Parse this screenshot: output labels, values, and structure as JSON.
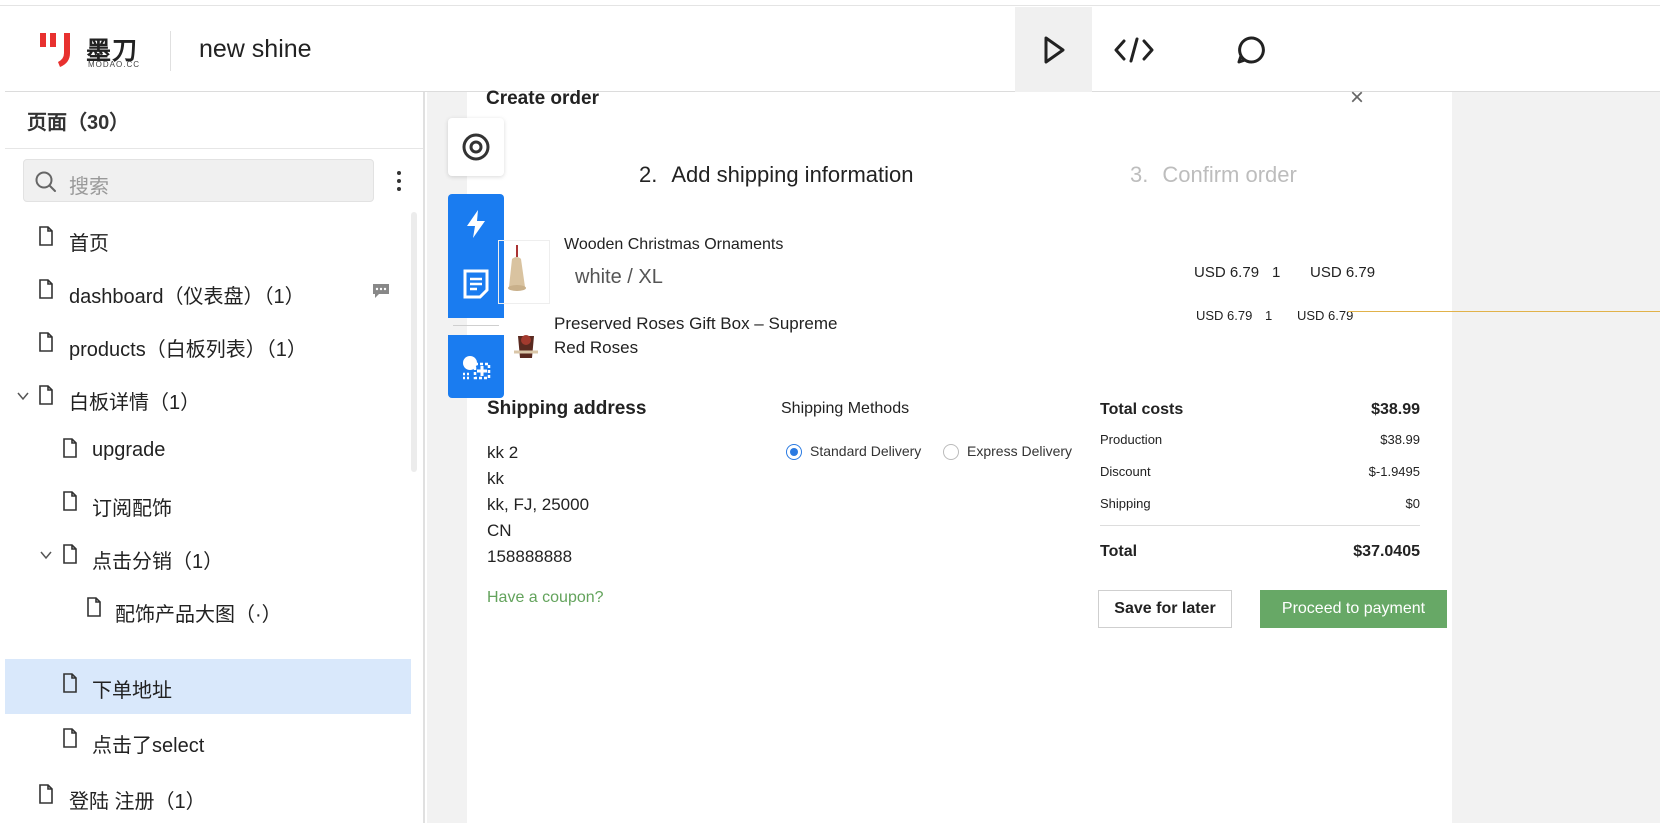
{
  "header": {
    "logo_cn": "墨刀",
    "logo_en": "MODAO.CC",
    "project_name": "new shine",
    "icons": [
      "play-icon",
      "code-icon",
      "comment-icon"
    ]
  },
  "sidebar": {
    "title": "页面（30）",
    "search_placeholder": "搜索",
    "items": [
      {
        "label": "首页"
      },
      {
        "label": "dashboard（仪表盘）（1）"
      },
      {
        "label": "products（白板列表）（1）"
      },
      {
        "label": "白板详情（1）"
      },
      {
        "label": "upgrade"
      },
      {
        "label": "订阅配饰"
      },
      {
        "label": "点击分销（1）"
      },
      {
        "label": "配饰产品大图（·）"
      },
      {
        "label": "下单地址"
      },
      {
        "label": "点击了select"
      },
      {
        "label": "登陆 注册（1）"
      }
    ],
    "selected": "下单地址"
  },
  "order": {
    "title": "Create order",
    "step2_num": "2.",
    "step2_label": "Add shipping information",
    "step3_num": "3.",
    "step3_label": "Confirm order",
    "products": [
      {
        "name": "Wooden Christmas Ornaments",
        "variant": "white / XL",
        "price": "USD 6.79",
        "qty": "1",
        "total": "USD 6.79"
      },
      {
        "name": "Preserved Roses Gift Box – Supreme Red Roses",
        "price": "USD 6.79",
        "qty": "1",
        "total": "USD 6.79"
      }
    ],
    "shipping_address": {
      "title": "Shipping address",
      "lines": [
        "kk 2",
        "kk",
        "kk, FJ, 25000",
        "CN",
        "158888888"
      ]
    },
    "shipping_methods": {
      "title": "Shipping Methods",
      "options": [
        "Standard Delivery",
        "Express Delivery"
      ],
      "selected": "Standard Delivery"
    },
    "costs": {
      "total_costs_label": "Total costs",
      "total_costs": "$38.99",
      "production_label": "Production",
      "production": "$38.99",
      "discount_label": "Discount",
      "discount": "$-1.9495",
      "shipping_label": "Shipping",
      "shipping": "$0",
      "total_label": "Total",
      "total": "$37.0405"
    },
    "coupon_link": "Have a coupon?",
    "save_button": "Save for later",
    "pay_button": "Proceed to payment"
  },
  "colors": {
    "logo_red": "#e8312f",
    "accent_blue": "#1a7cf0",
    "selected_row": "#d9e8fb",
    "pay_green": "#67a866",
    "coupon_green": "#63a35c"
  }
}
